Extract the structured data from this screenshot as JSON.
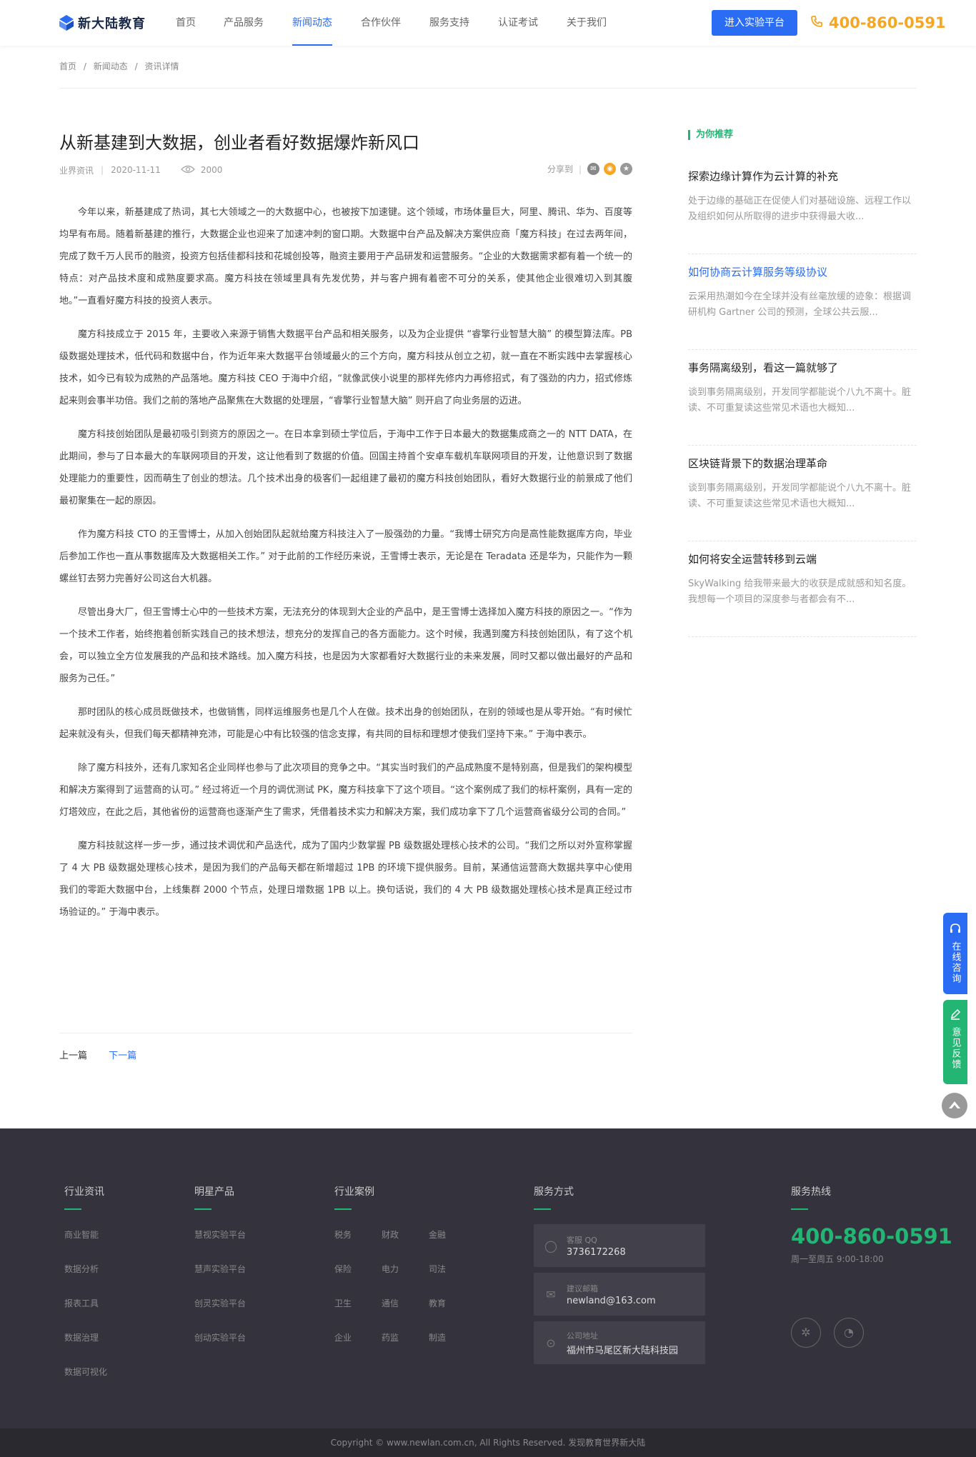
{
  "header": {
    "logo_text": "新大陆教育",
    "nav": [
      "首页",
      "产品服务",
      "新闻动态",
      "合作伙伴",
      "服务支持",
      "认证考试",
      "关于我们"
    ],
    "nav_active": 2,
    "cta_label": "进入实验平台",
    "phone": "400-860-0591",
    "accent_color": "#2b6cf5",
    "phone_color": "#f5a623"
  },
  "breadcrumb": [
    "首页",
    "/",
    "新闻动态",
    "/",
    "资讯详情"
  ],
  "article": {
    "title": "从新基建到大数据，创业者看好数据爆炸新风口",
    "category": "业界资讯",
    "date": "2020-11-11",
    "views": "2000",
    "share_label": "分享到",
    "paragraphs": [
      "今年以来，新基建成了热词，其七大领域之一的大数据中心，也被按下加速键。这个领域，市场体量巨大，阿里、腾讯、华为、百度等均早有布局。随着新基建的推行，大数据企业也迎来了加速冲刺的窗口期。大数据中台产品及解决方案供应商「魔方科技」在过去两年间，完成了数千万人民币的融资，投资方包括佳都科技和花城创投等，融资主要用于产品研发和运营服务。“企业的大数据需求都有着一个统一的特点：对产品技术度和成熟度要求高。魔方科技在领域里具有先发优势，并与客户拥有着密不可分的关系，使其他企业很难切入到其腹地。”一直看好魔方科技的投资人表示。",
      "魔方科技成立于 2015 年，主要收入来源于销售大数据平台产品和相关服务，以及为企业提供 “睿擎行业智慧大脑” 的模型算法库。PB 级数据处理技术，低代码和数据中台，作为近年来大数据平台领域最火的三个方向，魔方科技从创立之初，就一直在不断实践中去掌握核心技术，如今已有较为成熟的产品落地。魔方科技 CEO 于海中介绍，“就像武侠小说里的那样先修内力再修招式，有了强劲的内力，招式修炼起来则会事半功倍。我们之前的落地产品聚焦在大数据的处理层，“睿擎行业智慧大脑” 则开启了向业务层的迈进。",
      "魔方科技创始团队是最初吸引到资方的原因之一。在日本拿到硕士学位后，于海中工作于日本最大的数据集成商之一的 NTT DATA，在此期间，参与了日本最大的车联网项目的开发，这让他看到了数据的价值。回国主持首个安卓车载机车联网项目的开发，让他意识到了数据处理能力的重要性，因而萌生了创业的想法。几个技术出身的极客们一起组建了最初的魔方科技创始团队，看好大数据行业的前景成了他们最初聚集在一起的原因。",
      "作为魔方科技 CTO 的王雪博士，从加入创始团队起就给魔方科技注入了一股强劲的力量。“我博士研究方向是高性能数据库方向，毕业后参加工作也一直从事数据库及大数据相关工作。” 对于此前的工作经历来说，王雪博士表示，无论是在 Teradata 还是华为，只能作为一颗螺丝钉去努力完善好公司这台大机器。",
      "尽管出身大厂，但王雪博士心中的一些技术方案，无法充分的体现到大企业的产品中，是王雪博士选择加入魔方科技的原因之一。“作为一个技术工作者，始终抱着创新实践自己的技术想法，想充分的发挥自己的各方面能力。这个时候，我遇到魔方科技创始团队，有了这个机会，可以独立全方位发展我的产品和技术路线。加入魔方科技，也是因为大家都看好大数据行业的未来发展，同时又都以做出最好的产品和服务为己任。”",
      "那时团队的核心成员既做技术，也做销售，同样运维服务也是几个人在做。技术出身的创始团队，在别的领域也是从零开始。“有时候忙起来就没有头，但我们每天都精神充沛，可能是心中有比较强的信念支撑，有共同的目标和理想才使我们坚持下来。” 于海中表示。",
      "除了魔方科技外，还有几家知名企业同样也参与了此次项目的竞争之中。“其实当时我们的产品成熟度不是特别高，但是我们的架构模型和解决方案得到了运营商的认可。” 经过将近一个月的调优测试 PK，魔方科技拿下了这个项目。“这个案例成了我们的标杆案例，具有一定的灯塔效应，在此之后，其他省份的运营商也逐渐产生了需求，凭借着技术实力和解决方案，我们成功拿下了几个运营商省级分公司的合同。”",
      "魔方科技就这样一步一步，通过技术调优和产品迭代，成为了国内少数掌握 PB 级数据处理核心技术的公司。“我们之所以对外宣称掌握了 4 大 PB 级数据处理核心技术，是因为我们的产品每天都在新增超过 1PB 的环境下提供服务。目前，某通信运营商大数据共享中心使用我们的零距大数据中台，上线集群 2000 个节点，处理日增数据 1PB 以上。换句话说，我们的 4 大 PB 级数据处理核心技术是真正经过市场验证的。” 于海中表示。"
    ],
    "prev_label": "上一篇",
    "next_label": "下一篇"
  },
  "recommend": {
    "title": "为你推荐",
    "items": [
      {
        "title": "探索边缘计算作为云计算的补充",
        "desc": "处于边缘的基础正在促使人们对基础设施、远程工作以及组织如何从所取得的进步中获得最大收..."
      },
      {
        "title": "如何协商云计算服务等级协议",
        "desc": "云采用热潮如今在全球并没有丝毫放缓的迹象：根据调研机构 Gartner 公司的预测，全球公共云服..."
      },
      {
        "title": "事务隔离级别，看这一篇就够了",
        "desc": "谈到事务隔离级别，开发同学都能说个八九不离十。脏读、不可重复读这些常见术语也大概知..."
      },
      {
        "title": "区块链背景下的数据治理革命",
        "desc": "谈到事务隔离级别，开发同学都能说个八九不离十。脏读、不可重复读这些常见术语也大概知..."
      },
      {
        "title": "如何将安全运营转移到云端",
        "desc": "SkyWalking 给我带来最大的收获是成就感和知名度。我想每一个项目的深度参与者都会有不..."
      }
    ],
    "highlight_index": 1
  },
  "side": {
    "consult": "在线咨询",
    "feedback": "意见反馈"
  },
  "footer": {
    "col1": {
      "title": "行业资讯",
      "links": [
        "商业智能",
        "数据分析",
        "报表工具",
        "数据治理",
        "数据可视化"
      ]
    },
    "col2": {
      "title": "明星产品",
      "links": [
        "慧视实验平台",
        "慧声实验平台",
        "创灵实验平台",
        "创动实验平台"
      ]
    },
    "col3": {
      "title": "行业案例",
      "links": [
        "税务",
        "财政",
        "金融",
        "保险",
        "电力",
        "司法",
        "卫生",
        "通信",
        "教育",
        "企业",
        "药监",
        "制造"
      ]
    },
    "col4": {
      "title": "服务方式",
      "cards": [
        {
          "label": "客服 QQ",
          "value": "3736172268"
        },
        {
          "label": "建议邮箱",
          "value": "newland@163.com"
        },
        {
          "label": "公司地址",
          "value": "福州市马尾区新大陆科技园"
        }
      ]
    },
    "col5": {
      "title": "服务热线",
      "phone": "400-860-0591",
      "hours": "周一至周五 9:00-18:00"
    },
    "copyright": "Copyright © www.newlan.com.cn, All Rights Reserved. 发现教育世界新大陆"
  }
}
